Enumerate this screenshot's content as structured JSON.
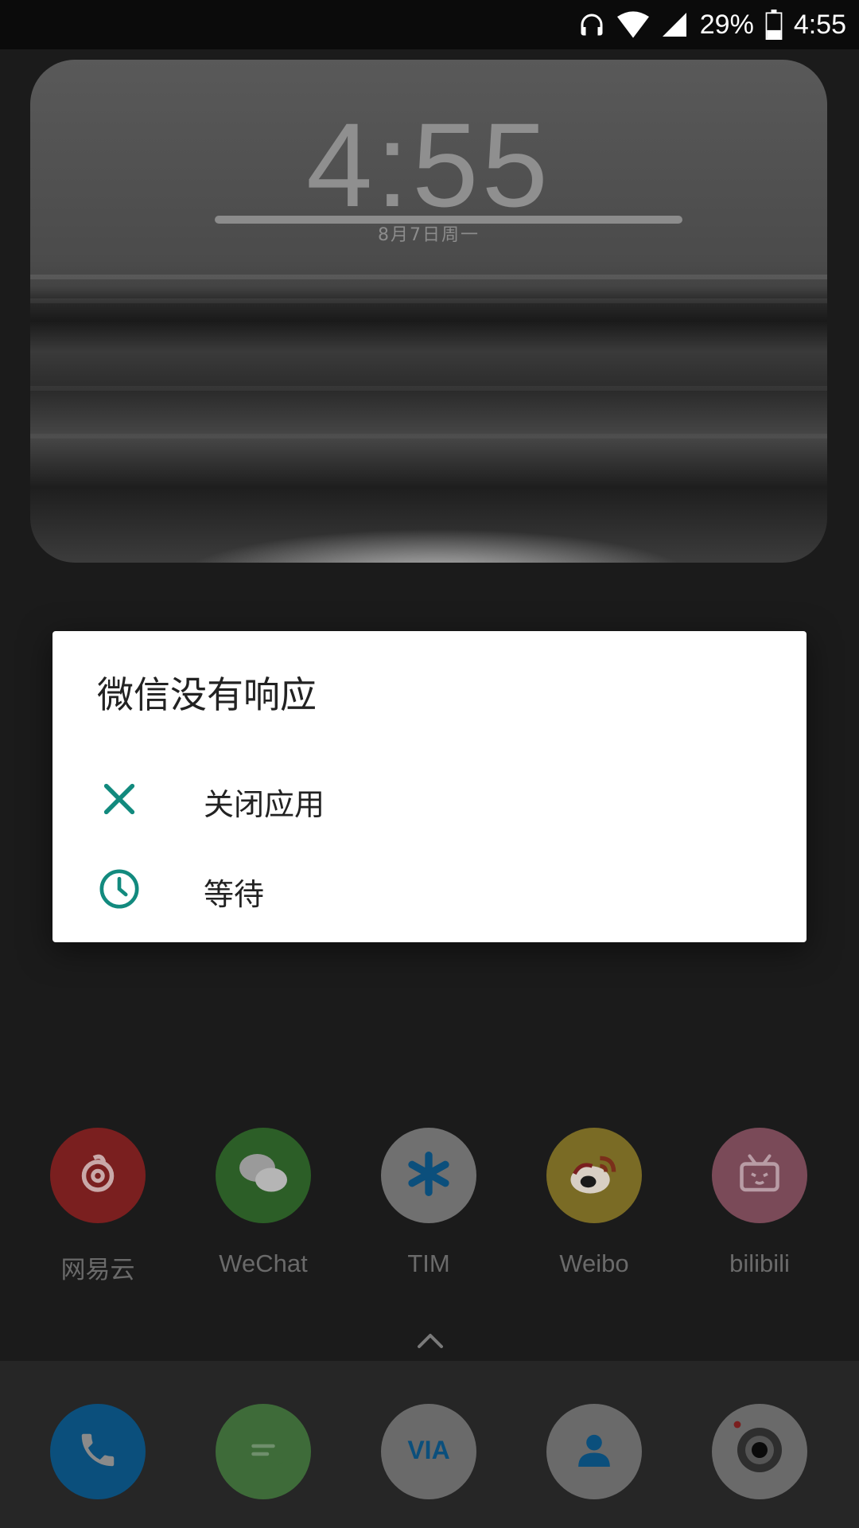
{
  "status_bar": {
    "battery_percent": "29%",
    "time": "4:55",
    "icons": [
      "headphones-icon",
      "wifi-icon",
      "cell-signal-icon",
      "battery-icon"
    ]
  },
  "clock_widget": {
    "time": "4:55",
    "date": "8月7日周一"
  },
  "dialog": {
    "title": "微信没有响应",
    "options": [
      {
        "label": "关闭应用",
        "icon": "close-icon",
        "color": "#128a7e"
      },
      {
        "label": "等待",
        "icon": "clock-icon",
        "color": "#128a7e"
      }
    ]
  },
  "home_apps": [
    {
      "label": "网易云",
      "icon": "netease-music-icon",
      "color": "#7a1f1f"
    },
    {
      "label": "WeChat",
      "icon": "wechat-icon",
      "color": "#2c5e27"
    },
    {
      "label": "TIM",
      "icon": "tim-icon",
      "color": "#707070"
    },
    {
      "label": "Weibo",
      "icon": "weibo-icon",
      "color": "#7a6b25"
    },
    {
      "label": "bilibili",
      "icon": "bilibili-icon",
      "color": "#7a4a58"
    }
  ],
  "dock_apps": [
    {
      "icon": "phone-icon",
      "color": "#0b4f7c"
    },
    {
      "icon": "messages-icon",
      "color": "#3e6b39"
    },
    {
      "icon": "via-browser-icon",
      "color": "#6a6a6a",
      "text": "VIA"
    },
    {
      "icon": "contacts-icon",
      "color": "#6a6a6a"
    },
    {
      "icon": "camera-icon",
      "color": "#6a6a6a"
    }
  ],
  "colors": {
    "accent": "#128a7e",
    "scrim": "#1b1b1b"
  }
}
